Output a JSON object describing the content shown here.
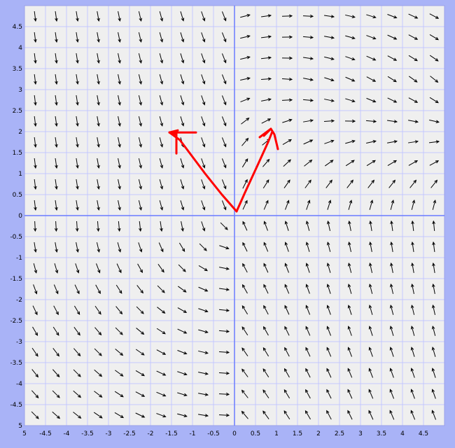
{
  "chart_data": {
    "type": "vector-field",
    "title": "",
    "xlabel": "",
    "ylabel": "",
    "xlim": [
      -5,
      5
    ],
    "ylim": [
      -5,
      5
    ],
    "grid": true,
    "grid_step": 0.5,
    "x_tick_labels": [
      "5",
      "-4.5",
      "-4",
      "-3.5",
      "-3",
      "-2.5",
      "-2",
      "-1.5",
      "-1",
      "-0.5",
      "0",
      "0.5",
      "1",
      "1.5",
      "2",
      "2.5",
      "3",
      "3.5",
      "4",
      "4.5"
    ],
    "x_tick_values": [
      -5,
      -4.5,
      -4,
      -3.5,
      -3,
      -2.5,
      -2,
      -1.5,
      -1,
      -0.5,
      0,
      0.5,
      1,
      1.5,
      2,
      2.5,
      3,
      3.5,
      4,
      4.5
    ],
    "y_tick_labels": [
      "4.5",
      "4",
      "3.5",
      "3",
      "2.5",
      "2",
      "1.5",
      "1",
      "0.5",
      "0",
      "-0.5",
      "-1",
      "-1.5",
      "-2",
      "-2.5",
      "-3",
      "-3.5",
      "-4",
      "-4.5",
      "5"
    ],
    "y_tick_values": [
      4.5,
      4,
      3.5,
      3,
      2.5,
      2,
      1.5,
      1,
      0.5,
      0,
      -0.5,
      -1,
      -1.5,
      -2,
      -2.5,
      -3,
      -3.5,
      -4,
      -4.5,
      -5
    ],
    "field_samples": {
      "x_values": [
        -4.75,
        -4.25,
        -3.75,
        -3.25,
        -2.75,
        -2.25,
        -1.75,
        -1.25,
        -0.75,
        -0.25,
        0.25,
        0.75,
        1.25,
        1.75,
        2.25,
        2.75,
        3.25,
        3.75,
        4.25,
        4.75
      ],
      "y_values": [
        4.75,
        4.25,
        3.75,
        3.25,
        2.75,
        2.25,
        1.75,
        1.25,
        0.75,
        0.25,
        -0.25,
        -0.75,
        -1.25,
        -1.75,
        -2.25,
        -2.75,
        -3.25,
        -3.75,
        -4.25,
        -4.75
      ]
    },
    "annotations": [
      {
        "kind": "freehand-arrow",
        "color": "#ff0000",
        "path": [
          [
            0.05,
            0.1
          ],
          [
            -0.3,
            0.5
          ],
          [
            -0.7,
            1.0
          ],
          [
            -1.0,
            1.4
          ],
          [
            -1.3,
            1.8
          ],
          [
            -1.55,
            1.98
          ]
        ],
        "head_at": [
          -1.55,
          1.98
        ]
      },
      {
        "kind": "freehand-arrow",
        "color": "#ff0000",
        "path": [
          [
            0.05,
            0.1
          ],
          [
            0.25,
            0.55
          ],
          [
            0.55,
            1.2
          ],
          [
            0.8,
            1.75
          ],
          [
            0.9,
            2.0
          ]
        ],
        "head_at": [
          0.9,
          2.0
        ]
      }
    ]
  },
  "colors": {
    "background": "#a9b3f7",
    "plot_area": "#efefef",
    "grid": "#c4c8ff",
    "axis": "#6a7cff",
    "arrows": "#000000",
    "annotation": "#ff0000"
  }
}
